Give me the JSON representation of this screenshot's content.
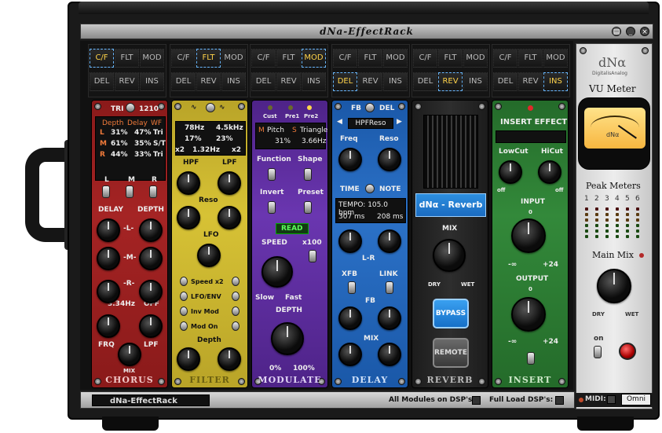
{
  "app": {
    "title": "dNa-EffectRack",
    "rack_name": "dNa-EffectRack"
  },
  "window": {
    "buttons": [
      "_",
      "×"
    ]
  },
  "slots": [
    {
      "top": [
        "C/F",
        "FLT",
        "MOD"
      ],
      "bottom": [
        "DEL",
        "REV",
        "INS"
      ],
      "active": "C/F"
    },
    {
      "top": [
        "C/F",
        "FLT",
        "MOD"
      ],
      "bottom": [
        "DEL",
        "REV",
        "INS"
      ],
      "active": "FLT"
    },
    {
      "top": [
        "C/F",
        "FLT",
        "MOD"
      ],
      "bottom": [
        "DEL",
        "REV",
        "INS"
      ],
      "active": "MOD"
    },
    {
      "top": [
        "C/F",
        "FLT",
        "MOD"
      ],
      "bottom": [
        "DEL",
        "REV",
        "INS"
      ],
      "active": "DEL"
    },
    {
      "top": [
        "C/F",
        "FLT",
        "MOD"
      ],
      "bottom": [
        "DEL",
        "REV",
        "INS"
      ],
      "active": "REV"
    },
    {
      "top": [
        "C/F",
        "FLT",
        "MOD"
      ],
      "bottom": [
        "DEL",
        "REV",
        "INS"
      ],
      "active": "INS"
    }
  ],
  "chorus": {
    "name": "CHORUS",
    "tri": "TRI",
    "rate": "1210",
    "headers": [
      "Depth",
      "Delay",
      "WF"
    ],
    "rows": [
      [
        "L",
        "31%",
        "47%",
        "Tri"
      ],
      [
        "M",
        "61%",
        "35%",
        "S/T"
      ],
      [
        "R",
        "44%",
        "33%",
        "Tri"
      ]
    ],
    "lfo": "3.34Hz",
    "lfo_state": "OFF",
    "toggle_labels": [
      "L",
      "M",
      "R"
    ],
    "knob_labels": {
      "delay": "DELAY",
      "depth": "DEPTH",
      "l": "-L-",
      "m": "-M-",
      "r": "-R-",
      "frq": "FRQ",
      "lpf": "LPF",
      "mix": "MIX"
    }
  },
  "filter": {
    "name": "FILTER",
    "lcd": [
      [
        "78Hz",
        "4.5kHz"
      ],
      [
        "17%",
        "23%"
      ],
      [
        "x2",
        "1.32Hz",
        "x2"
      ]
    ],
    "labels": {
      "hpf": "HPF",
      "lpf": "LPF",
      "reso": "Reso",
      "lfo": "LFO",
      "depth": "Depth"
    },
    "switches": [
      "Speed x2",
      "LFO/ENV",
      "Inv Mod",
      "Mod On"
    ]
  },
  "modulate": {
    "name": "MODULATE",
    "presets": [
      "Cust",
      "Pre1",
      "Pre2"
    ],
    "lcd": {
      "mode": "Pitch",
      "shape": "Triangle",
      "depth": "31%",
      "rate": "3.66Hz"
    },
    "labels": {
      "function": "Function",
      "shape": "Shape",
      "invert": "Invert",
      "preset": "Preset",
      "read": "READ",
      "speed": "SPEED",
      "x100": "x100",
      "slow": "Slow",
      "fast": "Fast",
      "depth": "DEPTH",
      "min": "0%",
      "max": "100%"
    }
  },
  "delay": {
    "name": "DELAY",
    "fb": "FB",
    "del": "DEL",
    "type": "HPFReso",
    "labels": {
      "freq": "Freq",
      "reso": "Reso",
      "time": "TIME",
      "note": "NOTE",
      "lr": "L-R",
      "xfb": "XFB",
      "link": "LINK",
      "fbk": "FB",
      "mix": "MIX"
    },
    "tempo": "TEMPO: 105.0 bpm",
    "time_l": "307 ms",
    "time_r": "208 ms"
  },
  "reverb": {
    "name": "REVERB",
    "title": "dNα - Reverb",
    "labels": {
      "mix": "MIX",
      "dry": "DRY",
      "wet": "WET"
    },
    "bypass": "BYPASS",
    "remote": "REMOTE"
  },
  "insert": {
    "name": "INSERT",
    "title": "INSERT EFFECT",
    "labels": {
      "lowcut": "LowCut",
      "hicut": "HiCut",
      "off1": "off",
      "off2": "off",
      "input": "INPUT",
      "output": "OUTPUT",
      "zero1": "0",
      "zero2": "0",
      "minf1": "-∞",
      "minf2": "-∞",
      "plus1": "+24",
      "plus2": "+24"
    }
  },
  "right_panel": {
    "logo": "dNα",
    "logo_sub": "DigitalisAnalog",
    "vu": "VU Meter",
    "vu_brand": "dNα",
    "peak": "Peak Meters",
    "channels": [
      "1",
      "2",
      "3",
      "4",
      "5",
      "6"
    ],
    "main_mix": "Main Mix",
    "dry": "DRY",
    "wet": "WET",
    "on": "on"
  },
  "bottom": {
    "all_modules": "All Modules on DSP's:",
    "full_load": "Full Load DSP's:",
    "midi": "MIDI:",
    "omni": "Omni"
  },
  "colors": {
    "chorus": "#9a1e1e",
    "filter": "#c9b22d",
    "modulate": "#5a2d9a",
    "delay": "#1e5fb0",
    "reverb": "#222222",
    "insert": "#2a7a32",
    "active_sel": "#ffd34a"
  }
}
